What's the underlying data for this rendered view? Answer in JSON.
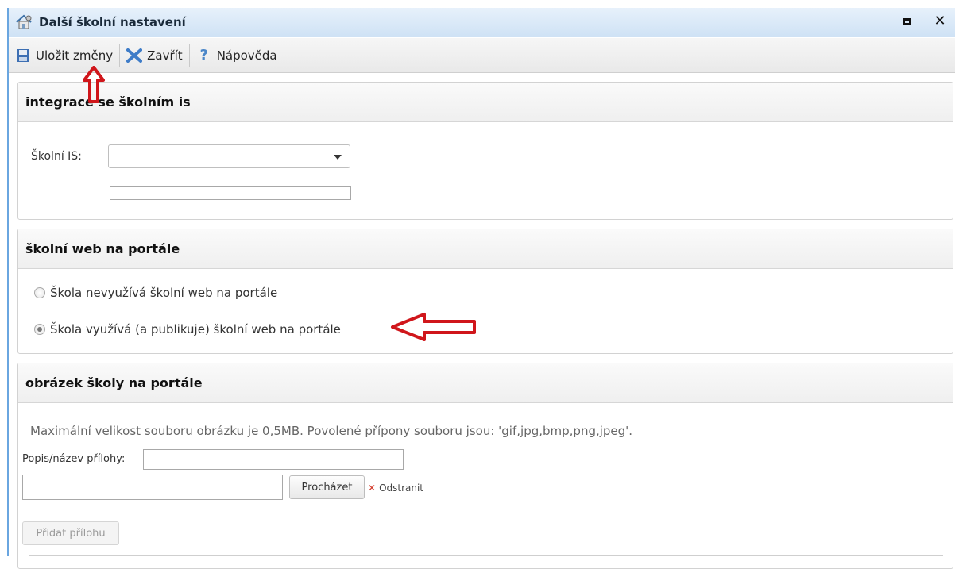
{
  "window": {
    "title": "Další školní nastavení"
  },
  "toolbar": {
    "save_label": "Uložit změny",
    "close_label": "Zavřít",
    "help_label": "Nápověda"
  },
  "integration": {
    "heading": "integrace se školním is",
    "school_is_label": "Školní IS:",
    "school_is_value": "",
    "extra_value": ""
  },
  "web": {
    "heading": "školní web na portále",
    "options": [
      {
        "label": "Škola nevyužívá školní web na portále",
        "checked": false
      },
      {
        "label": "Škola využívá (a publikuje) školní web na portále",
        "checked": true
      }
    ]
  },
  "image": {
    "heading": "obrázek školy na portále",
    "info": "Maximální velikost souboru obrázku je 0,5MB. Povolené přípony souboru jsou: 'gif,jpg,bmp,png,jpeg'.",
    "caption_label": "Popis/název přílohy:",
    "caption_value": "",
    "file_value": "",
    "browse_label": "Procházet",
    "remove_label": "Odstranit",
    "add_label": "Přidat přílohu"
  },
  "icons": {
    "title": "home-gear-icon",
    "save": "floppy-disk-icon",
    "close": "x-icon",
    "help": "question-mark-icon"
  },
  "colors": {
    "title_bar": "#cfe2f5",
    "annotation": "#d0161b"
  }
}
